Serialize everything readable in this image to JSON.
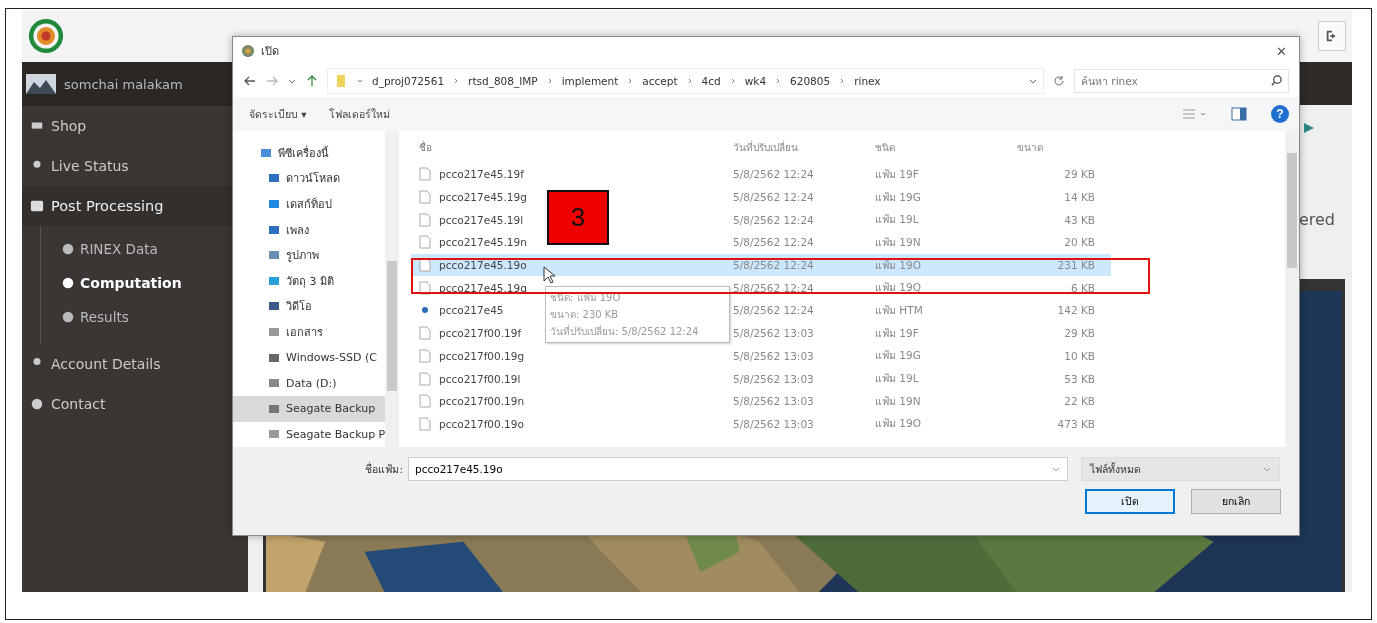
{
  "app": {
    "user": "somchai malakam",
    "nav": [
      {
        "label": "Shop",
        "expanded": false,
        "selected": false
      },
      {
        "label": "Live Status",
        "expanded": false,
        "selected": false
      },
      {
        "label": "Post Processing",
        "expanded": true,
        "selected": false,
        "children": [
          {
            "label": "RINEX Data",
            "selected": false
          },
          {
            "label": "Computation",
            "selected": true
          },
          {
            "label": "Results",
            "selected": false
          }
        ]
      },
      {
        "label": "Account Details",
        "expanded": false,
        "selected": false
      },
      {
        "label": "Contact",
        "expanded": false,
        "selected": false
      }
    ],
    "partial_text": "ered"
  },
  "dialog": {
    "title": "เปิด",
    "close": "✕",
    "breadcrumb": [
      "d_proj072561",
      "rtsd_808_IMP",
      "implement",
      "accept",
      "4cd",
      "wk4",
      "620805",
      "rinex"
    ],
    "search": {
      "placeholder": "ค้นหา rinex"
    },
    "toolbar": [
      "จัดระเบียบ ▾",
      "โฟลเดอร์ใหม่"
    ],
    "help": "?",
    "nav_pane": [
      {
        "label": "พีซีเครื่องนี้",
        "selected": false
      },
      {
        "label": "ดาวน์โหลด",
        "selected": false
      },
      {
        "label": "เดสก์ท็อป",
        "selected": false
      },
      {
        "label": "เพลง",
        "selected": false
      },
      {
        "label": "รูปภาพ",
        "selected": false
      },
      {
        "label": "วัตถุ 3 มิติ",
        "selected": false
      },
      {
        "label": "วิดีโอ",
        "selected": false
      },
      {
        "label": "เอกสาร",
        "selected": false
      },
      {
        "label": "Windows-SSD (C",
        "selected": false
      },
      {
        "label": "Data (D:)",
        "selected": false
      },
      {
        "label": "Seagate Backup",
        "selected": true
      },
      {
        "label": "Seagate Backup P",
        "selected": false
      }
    ],
    "columns": [
      "ชื่อ",
      "วันที่ปรับเปลี่ยน",
      "ชนิด",
      "ขนาด"
    ],
    "files": [
      {
        "name": "pcco217e45.19f",
        "modified": "5/8/2562 12:24",
        "type": "แฟ้ม 19F",
        "size": "29 KB",
        "kind": "file",
        "selected": false
      },
      {
        "name": "pcco217e45.19g",
        "modified": "5/8/2562 12:24",
        "type": "แฟ้ม 19G",
        "size": "14 KB",
        "kind": "file",
        "selected": false
      },
      {
        "name": "pcco217e45.19l",
        "modified": "5/8/2562 12:24",
        "type": "แฟ้ม 19L",
        "size": "43 KB",
        "kind": "file",
        "selected": false
      },
      {
        "name": "pcco217e45.19n",
        "modified": "5/8/2562 12:24",
        "type": "แฟ้ม 19N",
        "size": "20 KB",
        "kind": "file",
        "selected": false
      },
      {
        "name": "pcco217e45.19o",
        "modified": "5/8/2562 12:24",
        "type": "แฟ้ม 19O",
        "size": "231 KB",
        "kind": "file",
        "selected": true
      },
      {
        "name": "pcco217e45.19q",
        "modified": "5/8/2562 12:24",
        "type": "แฟ้ม 19Q",
        "size": "6 KB",
        "kind": "file",
        "selected": false
      },
      {
        "name": "pcco217e45",
        "modified": "5/8/2562 12:24",
        "type": "แฟ้ม HTM",
        "size": "142 KB",
        "kind": "web",
        "selected": false
      },
      {
        "name": "pcco217f00.19f",
        "modified": "5/8/2562 13:03",
        "type": "แฟ้ม 19F",
        "size": "29 KB",
        "kind": "file",
        "selected": false
      },
      {
        "name": "pcco217f00.19g",
        "modified": "5/8/2562 13:03",
        "type": "แฟ้ม 19G",
        "size": "10 KB",
        "kind": "file",
        "selected": false
      },
      {
        "name": "pcco217f00.19l",
        "modified": "5/8/2562 13:03",
        "type": "แฟ้ม 19L",
        "size": "53 KB",
        "kind": "file",
        "selected": false
      },
      {
        "name": "pcco217f00.19n",
        "modified": "5/8/2562 13:03",
        "type": "แฟ้ม 19N",
        "size": "22 KB",
        "kind": "file",
        "selected": false
      },
      {
        "name": "pcco217f00.19o",
        "modified": "5/8/2562 13:03",
        "type": "แฟ้ม 19O",
        "size": "473 KB",
        "kind": "file",
        "selected": false
      }
    ],
    "tooltip": [
      "ชนิด: แฟ้ม 19O",
      "ขนาด: 230 KB",
      "วันที่ปรับเปลี่ยน: 5/8/2562 12:24"
    ],
    "filename": {
      "label": "ชื่อแฟ้ม:",
      "value": "pcco217e45.19o"
    },
    "filter": "ไฟล์ทั้งหมด",
    "buttons": [
      {
        "label": "เปิด",
        "default": true
      },
      {
        "label": "ยกเลิก",
        "default": false
      }
    ]
  },
  "annotation": {
    "label": "3"
  }
}
